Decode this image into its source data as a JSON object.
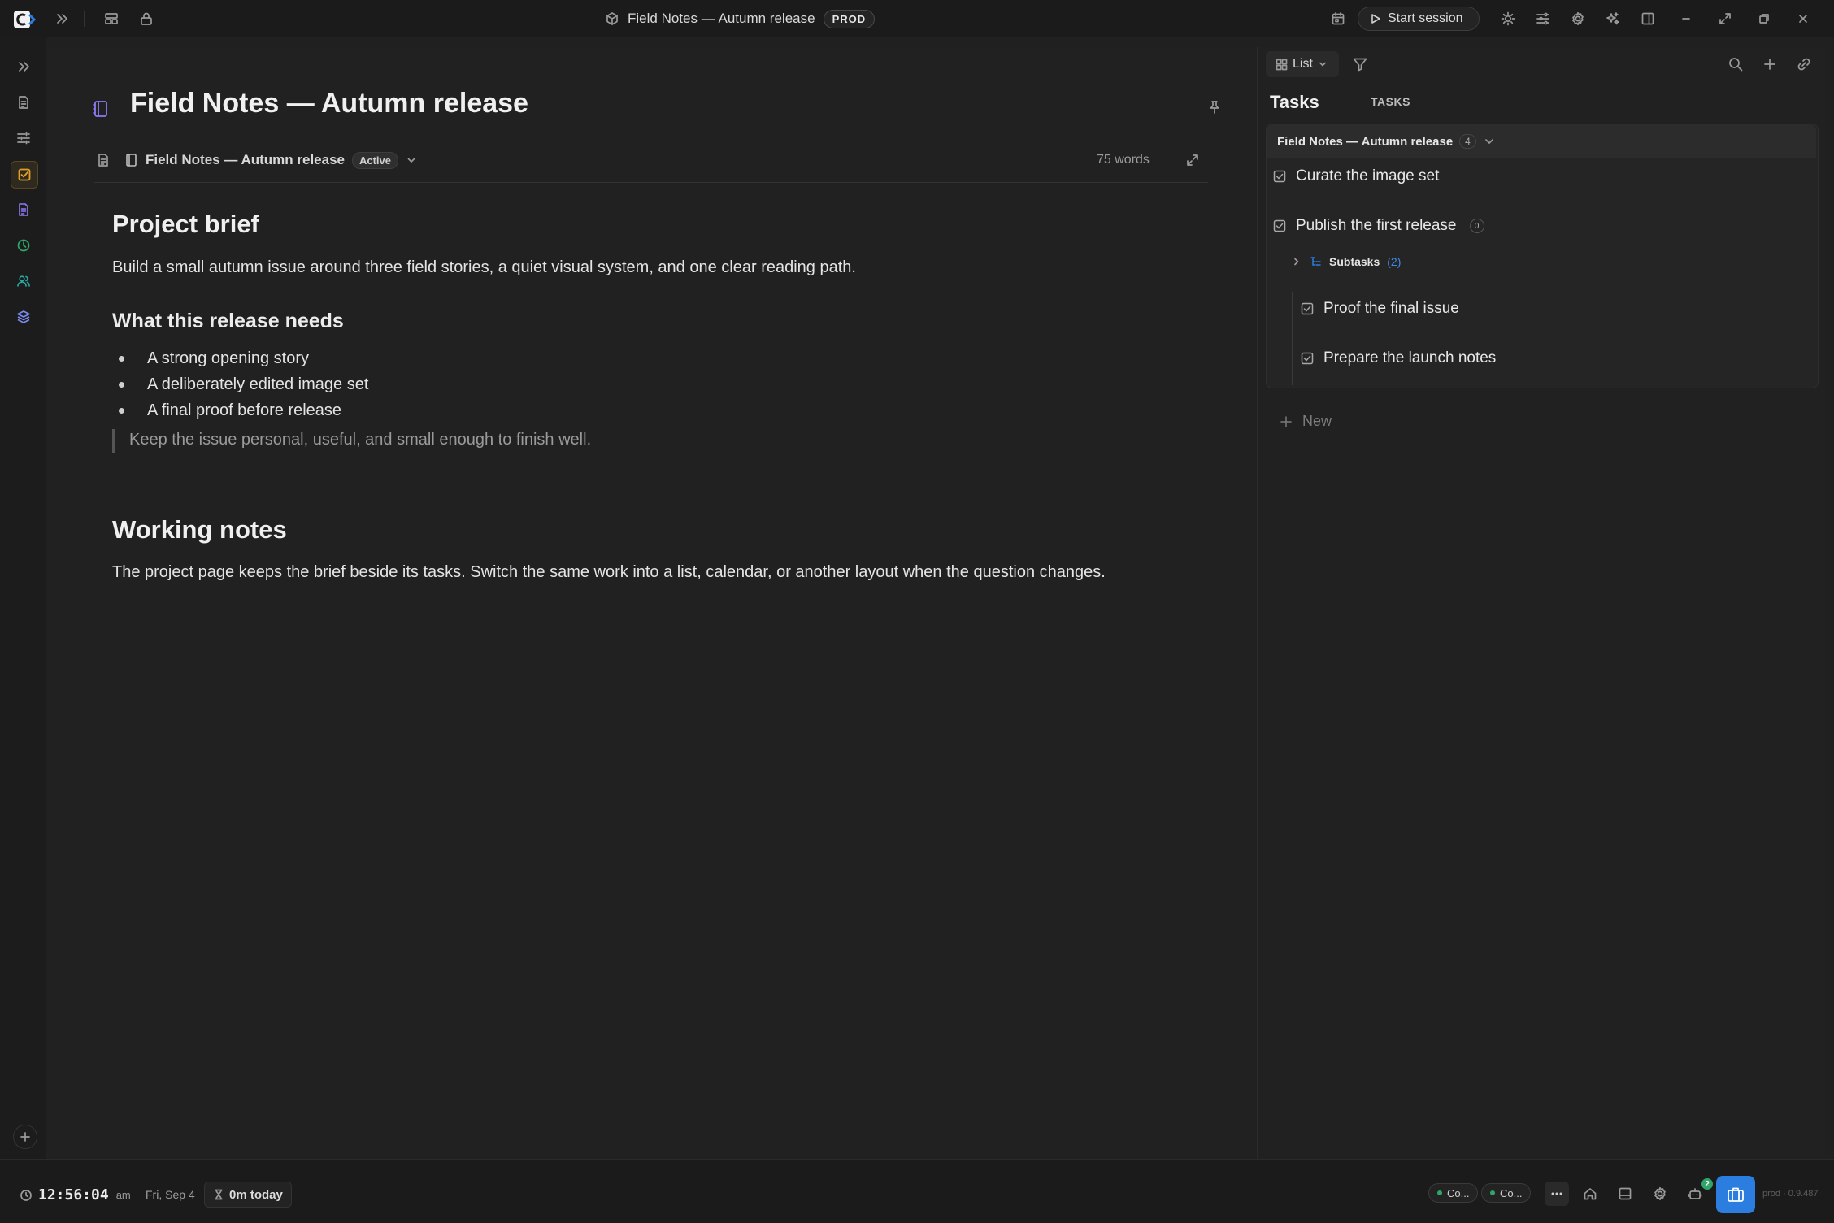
{
  "window": {
    "title": "Field Notes — Autumn release",
    "env_badge": "PROD",
    "start_session": "Start session"
  },
  "editor": {
    "title": "Field Notes — Autumn release",
    "breadcrumb_title": "Field Notes — Autumn release",
    "status_badge": "Active",
    "word_count": "75 words",
    "heading_brief": "Project brief",
    "brief_paragraph": "Build a small autumn issue around three field stories, a quiet visual system, and one clear reading path.",
    "heading_needs": "What this release needs",
    "needs": [
      "A strong opening story",
      "A deliberately edited image set",
      "A final proof before release"
    ],
    "quote": "Keep the issue personal, useful, and small enough to finish well.",
    "heading_notes": "Working notes",
    "notes_paragraph": "The project page keeps the brief beside its tasks. Switch the same work into a list, calendar, or another layout when the question changes."
  },
  "panel": {
    "view_label": "List",
    "title": "Tasks",
    "subtitle": "TASKS",
    "group_title": "Field Notes — Autumn release",
    "group_count": "4",
    "tasks": [
      {
        "title": "Curate the image set"
      },
      {
        "title": "Publish the first release",
        "badge": "0"
      }
    ],
    "subtasks_label": "Subtasks",
    "subtasks_count": "(2)",
    "subtasks": [
      {
        "title": "Proof the final issue"
      },
      {
        "title": "Prepare the launch notes"
      }
    ],
    "new_label": "New"
  },
  "statusbar": {
    "time": "12:56:04",
    "ampm": "am",
    "date": "Fri, Sep 4",
    "today": "0m today",
    "pill1": "Co...",
    "pill2": "Co...",
    "notif_count": "2",
    "version": "prod · 0.9.487"
  },
  "colors": {
    "accent_orange": "#e0a028",
    "accent_blue": "#2b7de0",
    "accent_purple": "#8b7cf6",
    "accent_green": "#2fa56a",
    "accent_teal": "#2aa7a0"
  }
}
